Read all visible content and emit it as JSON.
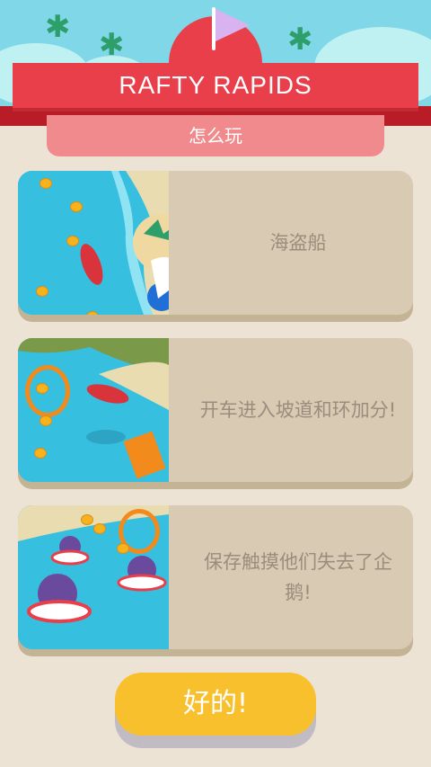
{
  "header": {
    "title": "RAFTY RAPIDS",
    "subtitle": "怎么玩"
  },
  "instructions": [
    {
      "text": "海盗船"
    },
    {
      "text": "开车进入坡道和环加分!"
    },
    {
      "text": "保存触摸他们失去了企鹅!"
    }
  ],
  "ok_button": {
    "label": "好的!"
  },
  "colors": {
    "ribbon": "#e83f4a",
    "subribbon": "#f08a8c",
    "card": "#d9cab3",
    "button": "#f9c02d",
    "background": "#ede3d4"
  }
}
